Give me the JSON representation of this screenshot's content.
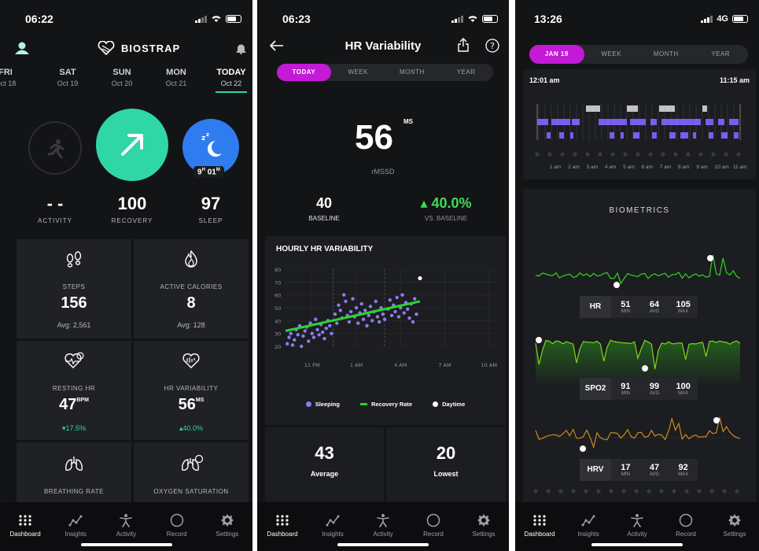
{
  "colors": {
    "accent": "#c31ad6",
    "recovery_teal": "#2fd6a6",
    "sleep_blue": "#2f7cf0",
    "green": "#28d62b",
    "sleeping_dot": "#8b7cf0"
  },
  "screen1": {
    "time": "06:22",
    "brand": "BIOSTRAP",
    "days": [
      {
        "dow": "FRI",
        "date": "Oct 18"
      },
      {
        "dow": "SAT",
        "date": "Oct 19"
      },
      {
        "dow": "SUN",
        "date": "Oct 20"
      },
      {
        "dow": "MON",
        "date": "Oct 21"
      },
      {
        "dow": "TODAY",
        "date": "Oct 22"
      }
    ],
    "activity": {
      "value": "- -",
      "label": "ACTIVITY"
    },
    "recovery": {
      "value": "100",
      "label": "RECOVERY"
    },
    "sleep": {
      "value": "97",
      "label": "SLEEP",
      "duration_h": "9",
      "h_unit": "H",
      "duration_m": "01",
      "m_unit": "M"
    },
    "tiles": [
      {
        "title": "STEPS",
        "value": "156",
        "unit": "",
        "sub": "Avg: 2,561"
      },
      {
        "title": "ACTIVE CALORIES",
        "value": "8",
        "unit": "",
        "sub": "Avg: 128"
      },
      {
        "title": "RESTING HR",
        "value": "47",
        "unit": "BPM",
        "sub": "▾17.5%"
      },
      {
        "title": "HR VARIABILITY",
        "value": "56",
        "unit": "MS",
        "sub": "▴40.0%"
      },
      {
        "title": "BREATHING RATE",
        "value": "",
        "unit": "",
        "sub": ""
      },
      {
        "title": "OXYGEN SATURATION",
        "value": "",
        "unit": "",
        "sub": ""
      }
    ]
  },
  "screen2": {
    "time": "06:23",
    "title": "HR Variability",
    "segments": [
      "TODAY",
      "WEEK",
      "MONTH",
      "YEAR"
    ],
    "main_value": "56",
    "main_unit": "MS",
    "main_label": "rMSSD",
    "baseline": {
      "value": "40",
      "label": "BASELINE"
    },
    "vs_baseline": {
      "value": "▴ 40.0%",
      "label": "VS. BASELINE"
    },
    "chart_title": "HOURLY HR VARIABILITY",
    "legend": [
      "Sleeping",
      "Recovery Rate",
      "Daytime"
    ],
    "average": {
      "value": "43",
      "label": "Average"
    },
    "lowest": {
      "value": "20",
      "label": "Lowest"
    }
  },
  "screen3": {
    "time": "13:26",
    "network": "4G",
    "segments": [
      "JAN 19",
      "WEEK",
      "MONTH",
      "YEAR"
    ],
    "range_start": "12:01 am",
    "range_end": "11:15 am",
    "hour_labels": [
      "1 am",
      "2 am",
      "3 am",
      "4 am",
      "5 am",
      "6 am",
      "7 am",
      "8 am",
      "9 am",
      "10 am",
      "11 am"
    ],
    "section_title": "BIOMETRICS",
    "metrics": [
      {
        "name": "HR",
        "min": "51",
        "avg": "64",
        "max": "105"
      },
      {
        "name": "SPO2",
        "min": "91",
        "avg": "99",
        "max": "100"
      },
      {
        "name": "HRV",
        "min": "17",
        "avg": "47",
        "max": "92"
      }
    ],
    "stat_labels": {
      "min": "MIN",
      "avg": "AVG",
      "max": "MAX"
    }
  },
  "tabbar": [
    "Dashboard",
    "Insights",
    "Activity",
    "Record",
    "Settings"
  ],
  "chart_data": {
    "type": "scatter",
    "title": "HOURLY HR VARIABILITY",
    "x_tick_labels": [
      "11 PM",
      "1 AM",
      "4 AM",
      "7 AM",
      "10 AM"
    ],
    "y_ticks": [
      20,
      30,
      40,
      50,
      60,
      70,
      80
    ],
    "ylim": [
      20,
      80
    ],
    "xlim": [
      0,
      12
    ],
    "grid": true,
    "legend_position": "bottom",
    "series": [
      {
        "name": "Sleeping",
        "points": [
          [
            0.1,
            22
          ],
          [
            0.2,
            27
          ],
          [
            0.3,
            30
          ],
          [
            0.4,
            21
          ],
          [
            0.5,
            25
          ],
          [
            0.6,
            33
          ],
          [
            0.7,
            29
          ],
          [
            0.8,
            36
          ],
          [
            0.9,
            20
          ],
          [
            1.0,
            28
          ],
          [
            1.1,
            32
          ],
          [
            1.2,
            35
          ],
          [
            1.3,
            24
          ],
          [
            1.4,
            38
          ],
          [
            1.5,
            30
          ],
          [
            1.6,
            27
          ],
          [
            1.7,
            41
          ],
          [
            1.8,
            33
          ],
          [
            1.9,
            29
          ],
          [
            2.0,
            37
          ],
          [
            2.1,
            31
          ],
          [
            2.2,
            26
          ],
          [
            2.3,
            34
          ],
          [
            2.4,
            40
          ],
          [
            2.5,
            36
          ],
          [
            2.6,
            30
          ],
          [
            2.8,
            45
          ],
          [
            2.9,
            38
          ],
          [
            3.0,
            52
          ],
          [
            3.1,
            48
          ],
          [
            3.2,
            42
          ],
          [
            3.3,
            60
          ],
          [
            3.4,
            55
          ],
          [
            3.5,
            44
          ],
          [
            3.6,
            39
          ],
          [
            3.7,
            47
          ],
          [
            3.8,
            57
          ],
          [
            3.9,
            43
          ],
          [
            4.0,
            50
          ],
          [
            4.1,
            38
          ],
          [
            4.2,
            46
          ],
          [
            4.3,
            53
          ],
          [
            4.4,
            41
          ],
          [
            4.5,
            48
          ],
          [
            4.6,
            36
          ],
          [
            4.7,
            44
          ],
          [
            4.8,
            51
          ],
          [
            4.9,
            40
          ],
          [
            5.0,
            47
          ],
          [
            5.1,
            55
          ],
          [
            5.2,
            43
          ],
          [
            5.3,
            39
          ],
          [
            5.4,
            50
          ],
          [
            5.5,
            45
          ],
          [
            5.6,
            41
          ],
          [
            5.8,
            49
          ],
          [
            5.9,
            56
          ],
          [
            6.0,
            44
          ],
          [
            6.1,
            52
          ],
          [
            6.2,
            47
          ],
          [
            6.3,
            58
          ],
          [
            6.4,
            43
          ],
          [
            6.5,
            50
          ],
          [
            6.6,
            60
          ],
          [
            6.7,
            46
          ],
          [
            6.8,
            54
          ],
          [
            6.9,
            49
          ],
          [
            7.0,
            42
          ],
          [
            7.1,
            53
          ],
          [
            7.2,
            39
          ],
          [
            7.3,
            57
          ],
          [
            7.4,
            45
          ]
        ]
      },
      {
        "name": "Daytime",
        "points": [
          [
            7.6,
            73
          ]
        ]
      }
    ],
    "trend": {
      "name": "Recovery Rate",
      "from": [
        0,
        32
      ],
      "to": [
        7.6,
        55
      ]
    }
  }
}
